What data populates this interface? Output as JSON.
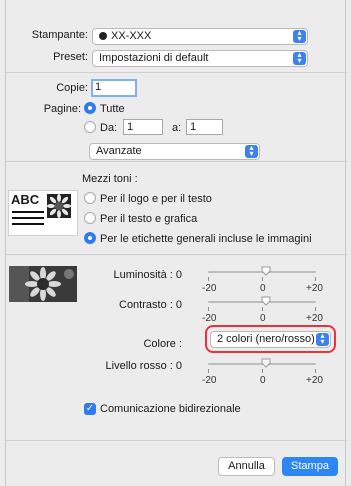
{
  "printer": {
    "label": "Stampante:",
    "value": "XX-XXX",
    "status_icon": "printer-status-dot"
  },
  "preset": {
    "label": "Preset:",
    "value": "Impostazioni di default"
  },
  "copies": {
    "label": "Copie:",
    "value": "1"
  },
  "pages": {
    "label": "Pagine:",
    "all_label": "Tutte",
    "from_label": "Da:",
    "from_value": "1",
    "to_label": "a:",
    "to_value": "1"
  },
  "section_popup": {
    "value": "Avanzate"
  },
  "halftone": {
    "label": "Mezzi toni :",
    "preview_text": "ABC",
    "options": [
      "Per il logo e per il testo",
      "Per il testo e grafica",
      "Per le etichette generali incluse le immagini"
    ],
    "selected_index": 2
  },
  "adjust": {
    "brightness": {
      "label": "Luminosità :",
      "value": "0",
      "level": 0
    },
    "contrast": {
      "label": "Contrasto :",
      "value": "0",
      "level": 0
    },
    "color": {
      "label": "Colore :",
      "value": "2 colori (nero/rosso)"
    },
    "red_level": {
      "label": "Livello rosso :",
      "value": "0",
      "level": 0
    },
    "scale": {
      "min": "-20",
      "mid": "0",
      "max": "+20"
    }
  },
  "bidirectional": {
    "label": "Comunicazione bidirezionale",
    "checked": true
  },
  "buttons": {
    "cancel": "Annulla",
    "print": "Stampa"
  },
  "colors": {
    "accent": "#2f7bf0",
    "highlight_ring": "#e8323c"
  }
}
